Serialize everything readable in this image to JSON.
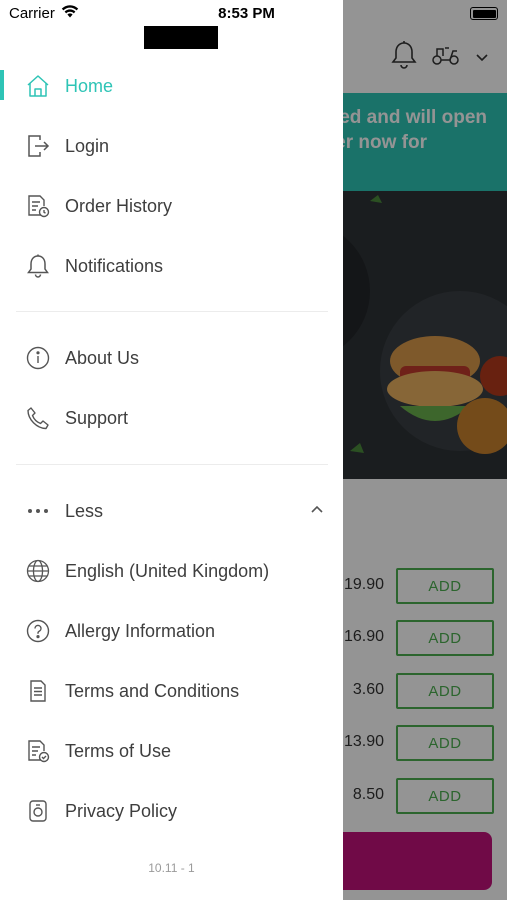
{
  "status_bar": {
    "carrier": "Carrier",
    "time": "8:53 PM"
  },
  "menu": {
    "primary": [
      {
        "id": "home",
        "label": "Home",
        "icon": "home-icon",
        "active": true
      },
      {
        "id": "login",
        "label": "Login",
        "icon": "login-icon"
      },
      {
        "id": "order-history",
        "label": "Order History",
        "icon": "order-history-icon"
      },
      {
        "id": "notifications",
        "label": "Notifications",
        "icon": "bell-icon"
      }
    ],
    "secondary": [
      {
        "id": "about-us",
        "label": "About Us",
        "icon": "info-icon"
      },
      {
        "id": "support",
        "label": "Support",
        "icon": "phone-icon"
      }
    ],
    "less": {
      "label": "Less",
      "icon": "more-dots-icon",
      "toggle_icon": "chevron-up-icon"
    },
    "extra": [
      {
        "id": "language",
        "label": "English (United Kingdom)",
        "icon": "globe-icon"
      },
      {
        "id": "allergy",
        "label": "Allergy Information",
        "icon": "question-icon"
      },
      {
        "id": "terms-conditions",
        "label": "Terms and Conditions",
        "icon": "document-icon"
      },
      {
        "id": "terms-of-use",
        "label": "Terms of Use",
        "icon": "document-check-icon"
      },
      {
        "id": "privacy-policy",
        "label": "Privacy Policy",
        "icon": "privacy-icon"
      }
    ]
  },
  "version": "10.11 - 1",
  "background": {
    "banner_lines": [
      "ed and will open",
      "rder now for"
    ],
    "items": [
      {
        "price": "19.90",
        "add_label": "ADD"
      },
      {
        "price": "16.90",
        "add_label": "ADD"
      },
      {
        "price": "3.60",
        "add_label": "ADD"
      },
      {
        "price": "13.90",
        "add_label": "ADD"
      },
      {
        "price": "8.50",
        "add_label": "ADD"
      }
    ]
  },
  "colors": {
    "accent": "#2ec4b6",
    "add_button": "#4caf50",
    "cta": "#c2127a"
  }
}
